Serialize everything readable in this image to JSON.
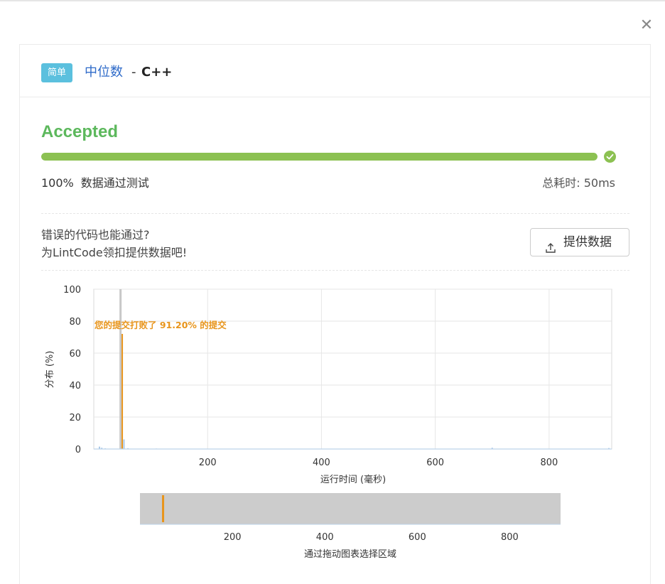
{
  "problem": {
    "difficulty": "简单",
    "name": "中位数",
    "separator": "-",
    "language": "C++"
  },
  "result": {
    "status": "Accepted",
    "progress_percent": 100,
    "passed_percent": "100%",
    "passed_text": "数据通过测试",
    "runtime_text": "总耗时: 50ms"
  },
  "contribute": {
    "line1": "错误的代码也能通过?",
    "line2": "为LintCode领扣提供数据吧!",
    "button_label": "提供数据"
  },
  "colors": {
    "accent": "#5cb85c",
    "progress": "#8cc152",
    "badge": "#5bc0de",
    "link": "#2f6bc9",
    "highlight": "#e8951c"
  },
  "icons": {
    "close": "close-icon",
    "check": "check-circle-icon",
    "upload": "upload-icon"
  },
  "chart_data": {
    "type": "bar",
    "title": "",
    "xlabel": "运行时间 (毫秒)",
    "ylabel": "分布 (%)",
    "xlim": [
      0,
      910
    ],
    "ylim": [
      0,
      100
    ],
    "x_ticks": [
      200,
      400,
      600,
      800
    ],
    "y_ticks": [
      0,
      20,
      40,
      60,
      80,
      100
    ],
    "grid": true,
    "annotation": "您的提交打败了 91.20% 的提交",
    "your_submission_ms": 50,
    "series": [
      {
        "points": [
          {
            "x": 10,
            "y": 1.5
          },
          {
            "x": 14,
            "y": 0.8
          },
          {
            "x": 20,
            "y": 0.4
          },
          {
            "x": 47,
            "y": 100
          },
          {
            "x": 50,
            "y": 72
          },
          {
            "x": 53,
            "y": 6
          },
          {
            "x": 60,
            "y": 0.5
          },
          {
            "x": 110,
            "y": 0.3
          },
          {
            "x": 700,
            "y": 0.8
          },
          {
            "x": 905,
            "y": 0.6
          }
        ]
      }
    ],
    "navigator": {
      "label": "通过拖动图表选择区域",
      "x_ticks": [
        200,
        400,
        600,
        800
      ]
    }
  }
}
